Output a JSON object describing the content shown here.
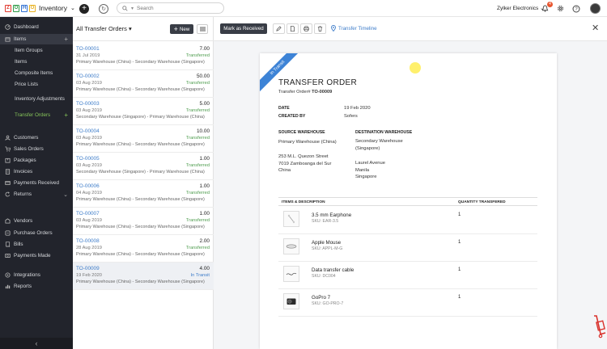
{
  "app": {
    "name": "Inventory",
    "org_name": "Zylker Electronics",
    "notification_count": "4"
  },
  "search": {
    "placeholder": "Search"
  },
  "sidebar": {
    "items": [
      {
        "label": "Dashboard"
      },
      {
        "label": "Items"
      },
      {
        "label": "Item Groups"
      },
      {
        "label": "Items"
      },
      {
        "label": "Composite Items"
      },
      {
        "label": "Price Lists"
      },
      {
        "label": "Inventory Adjustments"
      },
      {
        "label": "Transfer Orders"
      },
      {
        "label": "Customers"
      },
      {
        "label": "Sales Orders"
      },
      {
        "label": "Packages"
      },
      {
        "label": "Invoices"
      },
      {
        "label": "Payments Received"
      },
      {
        "label": "Returns"
      },
      {
        "label": "Vendors"
      },
      {
        "label": "Purchase Orders"
      },
      {
        "label": "Bills"
      },
      {
        "label": "Payments Made"
      },
      {
        "label": "Integrations"
      },
      {
        "label": "Reports"
      }
    ]
  },
  "list": {
    "title": "All Transfer Orders",
    "new_label": "New",
    "rows": [
      {
        "id": "TO-00001",
        "qty": "7.00",
        "date": "31 Jul 2019",
        "status": "Transferred",
        "route": "Primary Warehouse (China) - Secondary Warehouse (Singapore)"
      },
      {
        "id": "TO-00002",
        "qty": "50.00",
        "date": "03 Aug 2019",
        "status": "Transferred",
        "route": "Primary Warehouse (China) - Secondary Warehouse (Singapore)"
      },
      {
        "id": "TO-00003",
        "qty": "5.00",
        "date": "03 Aug 2019",
        "status": "Transferred",
        "route": "Secondary Warehouse (Singapore) - Primary Warehouse (China)"
      },
      {
        "id": "TO-00004",
        "qty": "10.00",
        "date": "03 Aug 2019",
        "status": "Transferred",
        "route": "Primary Warehouse (China) - Secondary Warehouse (Singapore)"
      },
      {
        "id": "TO-00005",
        "qty": "1.00",
        "date": "03 Aug 2019",
        "status": "Transferred",
        "route": "Secondary Warehouse (Singapore) - Primary Warehouse (China)"
      },
      {
        "id": "TO-00006",
        "qty": "1.00",
        "date": "04 Aug 2019",
        "status": "Transferred",
        "route": "Primary Warehouse (China) - Secondary Warehouse (Singapore)"
      },
      {
        "id": "TO-00007",
        "qty": "1.00",
        "date": "03 Aug 2019",
        "status": "Transferred",
        "route": "Primary Warehouse (China) - Secondary Warehouse (Singapore)"
      },
      {
        "id": "TO-00008",
        "qty": "2.00",
        "date": "28 Aug 2019",
        "status": "Transferred",
        "route": "Primary Warehouse (China) - Secondary Warehouse (Singapore)"
      },
      {
        "id": "TO-00009",
        "qty": "4.00",
        "date": "19 Feb 2020",
        "status": "In Transit",
        "route": "Primary Warehouse (China) - Secondary Warehouse (Singapore)"
      }
    ]
  },
  "detail": {
    "mark_received_label": "Mark as Received",
    "timeline_label": "Transfer Timeline",
    "ribbon": "In Transit",
    "title": "TRANSFER ORDER",
    "order_prefix": "Transfer Order#",
    "order_number": "TO-00009",
    "date_label": "DATE",
    "date_value": "19 Feb 2020",
    "created_label": "CREATED BY",
    "created_value": "Sofers",
    "source_label": "SOURCE WAREHOUSE",
    "source_name": "Primary Warehouse (China)",
    "source_address": "253 M.L. Quezon Street\n7019 Zamboanga del Sur\nChina",
    "dest_label": "DESTINATION WAREHOUSE",
    "dest_name": "Secondary Warehouse\n(Singapore)",
    "dest_address": "Laurel Avenue\nManila\nSingapore",
    "col_items": "ITEMS & DESCRIPTION",
    "col_qty": "QUANTITY TRANSFERED",
    "items": [
      {
        "name": "3.5 mm Earphone",
        "sku": "SKU: EAR-3.5",
        "qty": "1"
      },
      {
        "name": "Apple Mouse",
        "sku": "SKU: APPL-M-G",
        "qty": "1"
      },
      {
        "name": "Data transfer cable",
        "sku": "SKU: DC004",
        "qty": "1"
      },
      {
        "name": "GoPro 7",
        "sku": "SKU: GO-PRO-7",
        "qty": "1"
      }
    ]
  },
  "colors": {
    "accent_green": "#86c45a",
    "link_blue": "#3d7cc9",
    "sidebar_bg": "#22242c",
    "ribbon_blue": "#3d83d6"
  }
}
